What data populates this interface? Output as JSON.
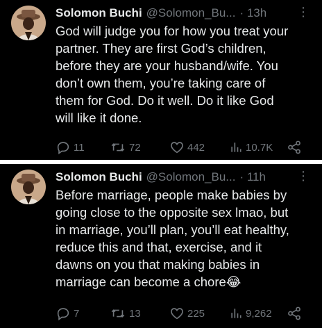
{
  "tweets": [
    {
      "author_name": "Solomon Buchi",
      "handle": "@Solomon_Bu...",
      "time": "· 13h",
      "more_glyph": "⋮",
      "lines": [
        "God will judge you for how you treat your",
        "partner. They are first God’s children,",
        "before they are your husband/wife. You",
        "don’t own them, you’re taking care of",
        "them for God. Do it well. Do it like God",
        "will like it done."
      ],
      "replies": "11",
      "reposts": "72",
      "likes": "442",
      "views": "10.7K"
    },
    {
      "author_name": "Solomon Buchi",
      "handle": "@Solomon_Bu...",
      "time": "· 11h",
      "more_glyph": "⋮",
      "lines": [
        "Before marriage, people make babies by",
        "going close to the opposite sex lmao, but",
        "in marriage, you’ll plan, you’ll eat healthy,",
        "reduce this and that, exercise, and it",
        "dawns on you that making babies in",
        "marriage can become a chore😂"
      ],
      "replies": "7",
      "reposts": "13",
      "likes": "225",
      "views": "9,262"
    }
  ],
  "icons": {
    "reply": "reply-icon",
    "repost": "repost-icon",
    "like": "heart-icon",
    "views": "views-icon",
    "share": "share-icon"
  },
  "colors": {
    "background": "#000000",
    "text": "#e7e9ea",
    "secondary": "#71767b",
    "separator": "#ffffff"
  }
}
